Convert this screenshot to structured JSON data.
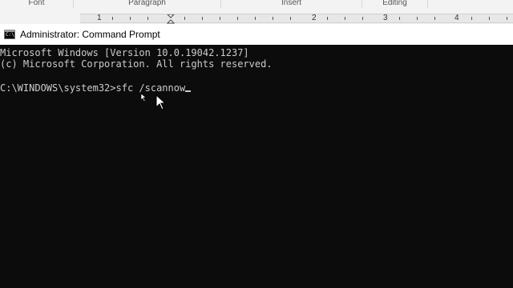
{
  "ribbon": {
    "groups": [
      {
        "id": "font",
        "label": "Font"
      },
      {
        "id": "paragraph",
        "label": "Paragraph"
      },
      {
        "id": "insert",
        "label": "Insert"
      },
      {
        "id": "editing",
        "label": "Editing"
      }
    ],
    "ruler_numbers": [
      "1",
      "2",
      "3",
      "4"
    ]
  },
  "window": {
    "title": "Administrator: Command Prompt",
    "icon": "cmd-icon"
  },
  "console": {
    "lines": [
      "Microsoft Windows [Version 10.0.19042.1237]",
      "(c) Microsoft Corporation. All rights reserved."
    ],
    "prompt": "C:\\WINDOWS\\system32>",
    "command": "sfc /scannow"
  },
  "colors": {
    "console_bg": "#0c0c0c",
    "console_text": "#cccccc",
    "titlebar_bg": "#ffffff"
  }
}
